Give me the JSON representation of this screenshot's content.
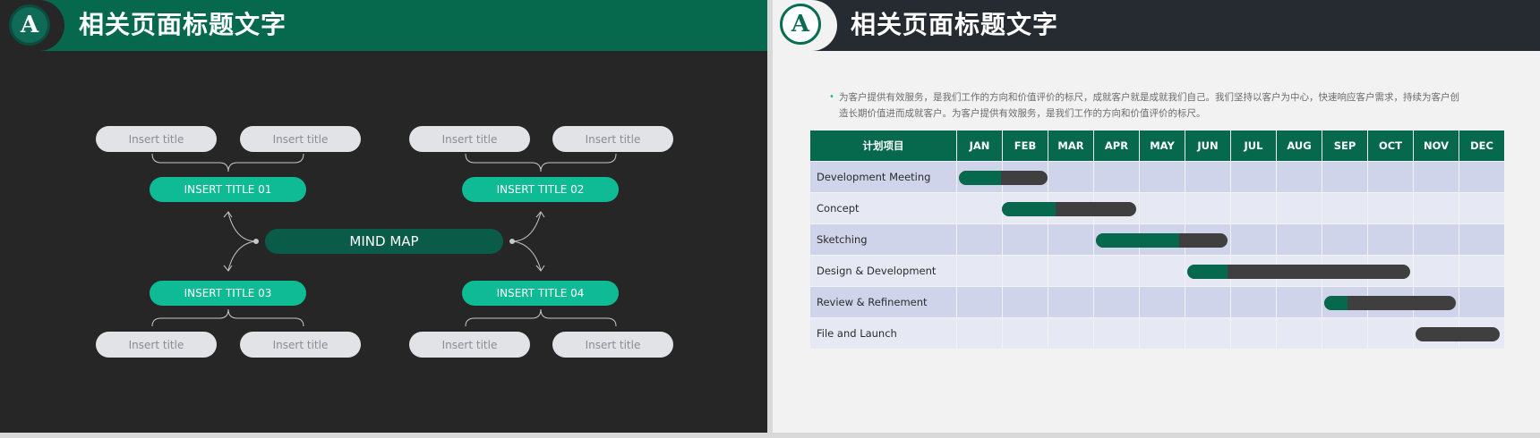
{
  "left_slide": {
    "title": "相关页面标题文字",
    "logo_letter": "A",
    "center_node": "MIND MAP",
    "branches": [
      {
        "label": "INSERT TITLE 01",
        "leaves": [
          "Insert title",
          "Insert title"
        ]
      },
      {
        "label": "INSERT TITLE 02",
        "leaves": [
          "Insert title",
          "Insert title"
        ]
      },
      {
        "label": "INSERT TITLE 03",
        "leaves": [
          "Insert title",
          "Insert title"
        ]
      },
      {
        "label": "INSERT TITLE 04",
        "leaves": [
          "Insert title",
          "Insert title"
        ]
      }
    ]
  },
  "right_slide": {
    "title": "相关页面标题文字",
    "logo_letter": "A",
    "bullet_line1": "为客户提供有效服务，是我们工作的方向和价值评价的标尺，成就客户就是成就我们自己。我们坚持以客户为中心，快速响应客户需求，持续为客户创",
    "bullet_line2": "造长期价值进而成就客户。为客户提供有效服务，是我们工作的方向和价值评价的标尺。",
    "gantt": {
      "header_task": "计划项目",
      "months": [
        "JAN",
        "FEB",
        "MAR",
        "APR",
        "MAY",
        "JUN",
        "JUL",
        "AUG",
        "SEP",
        "OCT",
        "NOV",
        "DEC"
      ],
      "tasks": [
        {
          "name": "Development Meeting",
          "start": 0.05,
          "end": 2.0,
          "progress": 0.48
        },
        {
          "name": "Concept",
          "start": 1.0,
          "end": 3.95,
          "progress": 0.4
        },
        {
          "name": "Sketching",
          "start": 3.05,
          "end": 5.95,
          "progress": 0.63
        },
        {
          "name": "Design & Development",
          "start": 5.05,
          "end": 9.95,
          "progress": 0.18
        },
        {
          "name": "Review & Refinement",
          "start": 8.05,
          "end": 10.95,
          "progress": 0.18
        },
        {
          "name": "File and Launch",
          "start": 10.05,
          "end": 11.9,
          "progress": 0.0
        }
      ]
    },
    "colors": {
      "bar": "#3f3f3f",
      "progress": "#06694e",
      "header": "#06694e"
    }
  }
}
